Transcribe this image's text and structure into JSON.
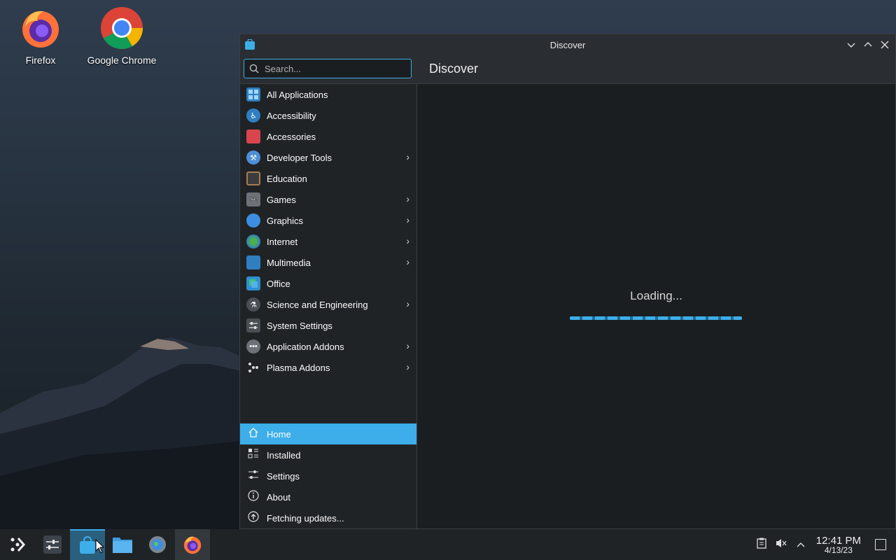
{
  "desktop": {
    "icons": [
      {
        "label": "Firefox"
      },
      {
        "label": "Google Chrome"
      }
    ]
  },
  "window": {
    "title": "Discover",
    "controls": [
      "minimize",
      "maximize",
      "close"
    ]
  },
  "search": {
    "placeholder": "Search..."
  },
  "page_title": "Discover",
  "categories": [
    {
      "label": "All Applications",
      "has_submenu": false,
      "icon": "grid-icon"
    },
    {
      "label": "Accessibility",
      "has_submenu": false,
      "icon": "accessibility-icon"
    },
    {
      "label": "Accessories",
      "has_submenu": false,
      "icon": "toolbox-icon"
    },
    {
      "label": "Developer Tools",
      "has_submenu": true,
      "icon": "hammer-icon"
    },
    {
      "label": "Education",
      "has_submenu": false,
      "icon": "blackboard-icon"
    },
    {
      "label": "Games",
      "has_submenu": true,
      "icon": "gamepad-icon"
    },
    {
      "label": "Graphics",
      "has_submenu": true,
      "icon": "palette-icon"
    },
    {
      "label": "Internet",
      "has_submenu": true,
      "icon": "globe-icon"
    },
    {
      "label": "Multimedia",
      "has_submenu": true,
      "icon": "monitor-icon"
    },
    {
      "label": "Office",
      "has_submenu": false,
      "icon": "office-icon"
    },
    {
      "label": "Science and Engineering",
      "has_submenu": true,
      "icon": "flask-icon"
    },
    {
      "label": "System Settings",
      "has_submenu": false,
      "icon": "settings-panel-icon"
    },
    {
      "label": "Application Addons",
      "has_submenu": true,
      "icon": "addons-icon"
    },
    {
      "label": "Plasma Addons",
      "has_submenu": true,
      "icon": "plasma-icon"
    }
  ],
  "nav": [
    {
      "label": "Home",
      "icon": "home-icon",
      "active": true
    },
    {
      "label": "Installed",
      "icon": "installed-icon",
      "active": false
    },
    {
      "label": "Settings",
      "icon": "sliders-icon",
      "active": false
    },
    {
      "label": "About",
      "icon": "info-icon",
      "active": false
    },
    {
      "label": "Fetching updates...",
      "icon": "update-icon",
      "active": false
    }
  ],
  "content": {
    "loading_text": "Loading..."
  },
  "taskbar": {
    "clock_time": "12:41 PM",
    "clock_date": "4/13/23"
  },
  "colors": {
    "accent": "#3daee9",
    "window_bg": "#1b1e20",
    "sidebar_bg": "#202326",
    "titlebar_bg": "#2a2e32"
  }
}
